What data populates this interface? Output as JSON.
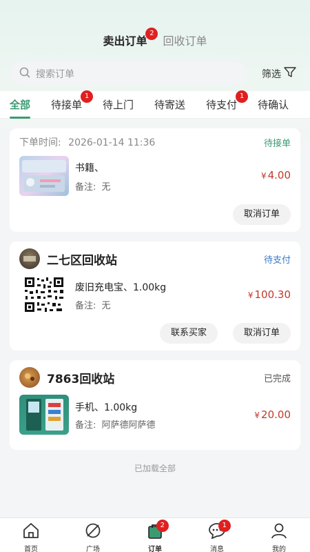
{
  "header": {
    "tabs": [
      {
        "label": "卖出订单",
        "badge": "2"
      },
      {
        "label": "回收订单"
      }
    ]
  },
  "search": {
    "placeholder": "搜索订单",
    "filter_label": "筛选"
  },
  "status_tabs": [
    {
      "label": "全部"
    },
    {
      "label": "待接单",
      "badge": "1"
    },
    {
      "label": "待上门"
    },
    {
      "label": "待寄送"
    },
    {
      "label": "待支付",
      "badge": "1"
    },
    {
      "label": "待确认"
    }
  ],
  "orders": [
    {
      "time_label": "下单时间:",
      "time": "2026-01-14 11:36",
      "status": "待接单",
      "item": "书籍、",
      "note_label": "备注:",
      "note": "无",
      "currency": "¥",
      "price": "4.00",
      "actions": [
        "取消订单"
      ]
    },
    {
      "station": "二七区回收站",
      "status": "待支付",
      "item": "废旧充电宝、1.00kg",
      "note_label": "备注:",
      "note": "无",
      "currency": "¥",
      "price": "100.30",
      "actions": [
        "联系买家",
        "取消订单"
      ]
    },
    {
      "station": "7863回收站",
      "status": "已完成",
      "item": "手机、1.00kg",
      "note_label": "备注:",
      "note": "阿萨德阿萨德",
      "currency": "¥",
      "price": "20.00",
      "actions": []
    }
  ],
  "footer_text": "已加载全部",
  "bottom_nav": [
    {
      "label": "首页",
      "icon": "home-icon"
    },
    {
      "label": "广场",
      "icon": "compass-icon"
    },
    {
      "label": "订单",
      "icon": "bag-icon",
      "badge": "2"
    },
    {
      "label": "消息",
      "icon": "chat-icon",
      "badge": "1"
    },
    {
      "label": "我的",
      "icon": "user-icon"
    }
  ],
  "colors": {
    "accent": "#3b9a72",
    "price": "#c0392b",
    "status_pending": "#3b9a72",
    "status_pay": "#3a78c8",
    "status_done": "#555555",
    "badge": "#e02020"
  }
}
